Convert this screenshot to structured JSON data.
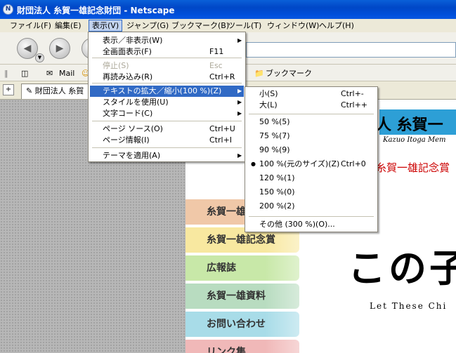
{
  "window": {
    "title": "財団法人 糸賀一雄記念財団 - Netscape",
    "icon": "netscape-icon"
  },
  "menubar": {
    "items": [
      "ファイル(F)",
      "編集(E)",
      "表示(V)",
      "ジャンプ(G)",
      "ブックマーク(B)",
      "ツール(T)",
      "ウィンドウ(W)",
      "ヘルプ(H)"
    ]
  },
  "personal_bar": {
    "mail": "Mail",
    "bookmarks": "ブックマーク"
  },
  "tab": {
    "label": "財団法人 糸賀"
  },
  "view_menu": {
    "items": [
      {
        "label": "表示／非表示(W)",
        "shortcut": "",
        "submenu": true,
        "disabled": false
      },
      {
        "label": "全画面表示(F)",
        "shortcut": "F11",
        "submenu": false,
        "disabled": false
      },
      {
        "label": "停止(S)",
        "shortcut": "Esc",
        "submenu": false,
        "disabled": true
      },
      {
        "label": "再読み込み(R)",
        "shortcut": "Ctrl+R",
        "submenu": false,
        "disabled": false
      },
      {
        "label": "テキストの拡大／縮小(100 %)(Z)",
        "shortcut": "",
        "submenu": true,
        "disabled": false,
        "highlighted": true
      },
      {
        "label": "スタイルを使用(U)",
        "shortcut": "",
        "submenu": true,
        "disabled": false
      },
      {
        "label": "文字コード(C)",
        "shortcut": "",
        "submenu": true,
        "disabled": false
      },
      {
        "label": "ページ ソース(O)",
        "shortcut": "Ctrl+U",
        "submenu": false,
        "disabled": false
      },
      {
        "label": "ページ情報(I)",
        "shortcut": "Ctrl+I",
        "submenu": false,
        "disabled": false
      },
      {
        "label": "テーマを適用(A)",
        "shortcut": "",
        "submenu": true,
        "disabled": false
      }
    ]
  },
  "zoom_menu": {
    "items": [
      {
        "label": "小(S)",
        "shortcut": "Ctrl+-",
        "checked": false
      },
      {
        "label": "大(L)",
        "shortcut": "Ctrl++",
        "checked": false
      },
      {
        "label": "50 %(5)",
        "shortcut": "",
        "checked": false
      },
      {
        "label": "75 %(7)",
        "shortcut": "",
        "checked": false
      },
      {
        "label": "90 %(9)",
        "shortcut": "",
        "checked": false
      },
      {
        "label": "100 %(元のサイズ)(Z)",
        "shortcut": "Ctrl+0",
        "checked": true
      },
      {
        "label": "120 %(1)",
        "shortcut": "",
        "checked": false
      },
      {
        "label": "150 %(0)",
        "shortcut": "",
        "checked": false
      },
      {
        "label": "200 %(2)",
        "shortcut": "",
        "checked": false
      },
      {
        "label": "その他 (300 %)(O)...",
        "shortcut": "",
        "checked": false
      }
    ]
  },
  "page": {
    "header_text": "人 糸賀一",
    "header_sub": "Kazuo Itoga Mem",
    "red_text": "糸賀一雄記念賞",
    "big_title": "この子",
    "subtitle": "Let These Chi",
    "nav": [
      {
        "label": "糸賀一雄",
        "color": "#f0c8a8"
      },
      {
        "label": "糸賀一雄記念賞",
        "color": "#f8e8a0"
      },
      {
        "label": "広報誌",
        "color": "#c8e8a8"
      },
      {
        "label": "糸賀一雄資料",
        "color": "#b8dcc0"
      },
      {
        "label": "お問い合わせ",
        "color": "#a8dce8"
      },
      {
        "label": "リンク集",
        "color": "#f0b8b8"
      }
    ]
  }
}
